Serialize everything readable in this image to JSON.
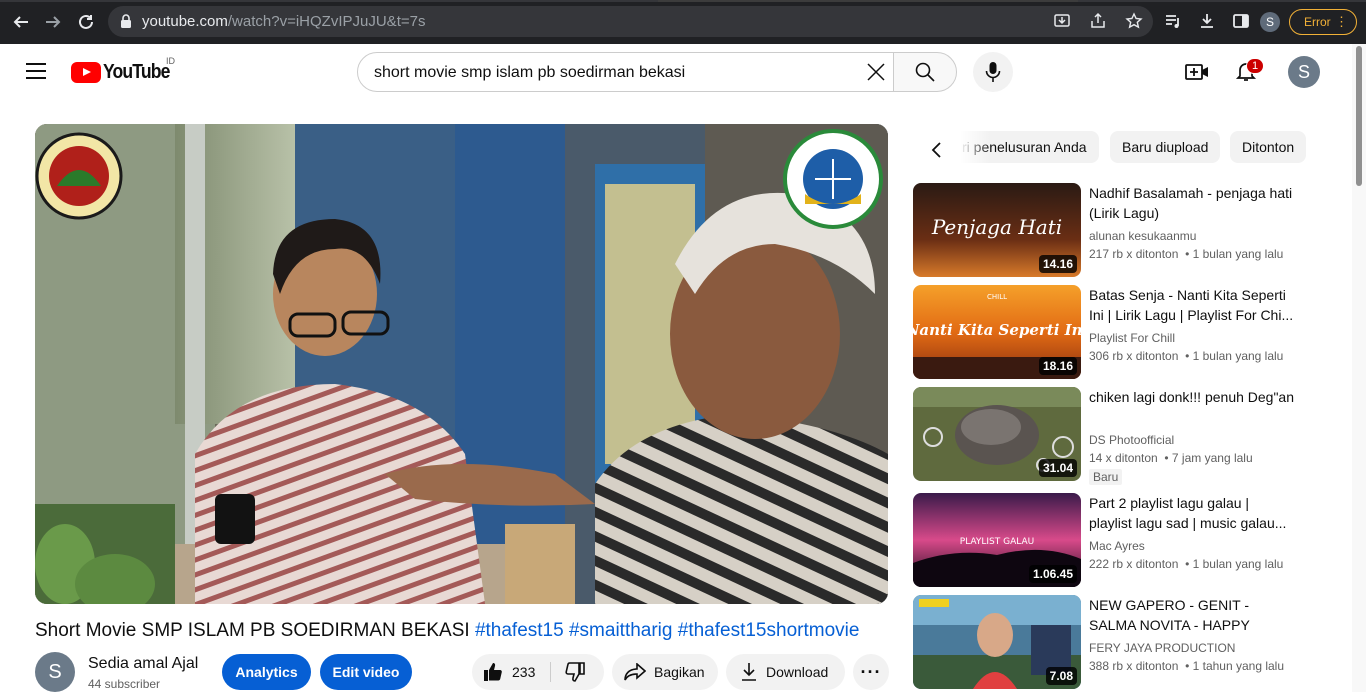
{
  "browser": {
    "url_host": "youtube.com",
    "url_path": "/watch?v=iHQZvIPJuJU&t=7s",
    "profile_initial": "S",
    "error_label": "Error"
  },
  "header": {
    "logo_text": "YouTube",
    "country_code": "ID",
    "search_query": "short movie smp islam pb soedirman bekasi",
    "notification_count": "1",
    "avatar_initial": "S"
  },
  "video": {
    "title_text": "Short Movie SMP ISLAM PB SOEDIRMAN BEKASI",
    "hashtags": [
      "#thafest15",
      "#smaittharig",
      "#thafest15shortmovie"
    ],
    "watermark_left": "SMP ISLAM PB. SOEDIRMAN · KOTA BEKASI",
    "watermark_right": "LEMBAGA PENDIDIKAN ISLAM TERPADU · THARIQ BIN ZIYAD"
  },
  "channel": {
    "avatar_initial": "S",
    "name": "Sedia amal Ajal",
    "subscribers": "44 subscriber"
  },
  "actions": {
    "analytics_label": "Analytics",
    "edit_label": "Edit video",
    "like_count": "233",
    "share_label": "Bagikan",
    "download_label": "Download"
  },
  "chips": [
    "ri penelusuran Anda",
    "Baru diupload",
    "Ditonton"
  ],
  "recommendations": [
    {
      "title": "Nadhif Basalamah - penjaga hati (Lirik Lagu)",
      "thumb_text": "Penjaga Hati",
      "channel": "alunan kesukaanmu",
      "views": "217 rb x ditonton",
      "age": "1 bulan yang lalu",
      "duration": "14.16",
      "badge": ""
    },
    {
      "title": "Batas Senja - Nanti Kita Seperti Ini | Lirik Lagu | Playlist For Chi...",
      "thumb_text": "Nanti Kita Seperti Ini",
      "thumb_small": "CHILL",
      "channel": "Playlist For Chill",
      "views": "306 rb x ditonton",
      "age": "1 bulan yang lalu",
      "duration": "18.16",
      "badge": ""
    },
    {
      "title": "chiken lagi donk!!! penuh Deg\"an",
      "channel": "DS Photoofficial",
      "views": "14 x ditonton",
      "age": "7 jam yang lalu",
      "duration": "31.04",
      "badge": "Baru"
    },
    {
      "title": "Part 2 playlist lagu galau | playlist lagu sad | music galau...",
      "thumb_text": "PLAYLIST GALAU",
      "channel": "Mac Ayres",
      "views": "222 rb x ditonton",
      "age": "1 bulan yang lalu",
      "duration": "1.06.45",
      "badge": ""
    },
    {
      "title": "NEW GAPERO - GENIT - SALMA NOVITA - HAPPY PARTY...",
      "channel": "FERY JAYA PRODUCTION",
      "views": "388 rb x ditonton",
      "age": "1 tahun yang lalu",
      "duration": "7.08",
      "badge": ""
    }
  ],
  "colors": {
    "chrome_bg": "#202124",
    "brand_red": "#ff0000",
    "link_blue": "#065fd4",
    "error_amber": "#f2b137"
  }
}
